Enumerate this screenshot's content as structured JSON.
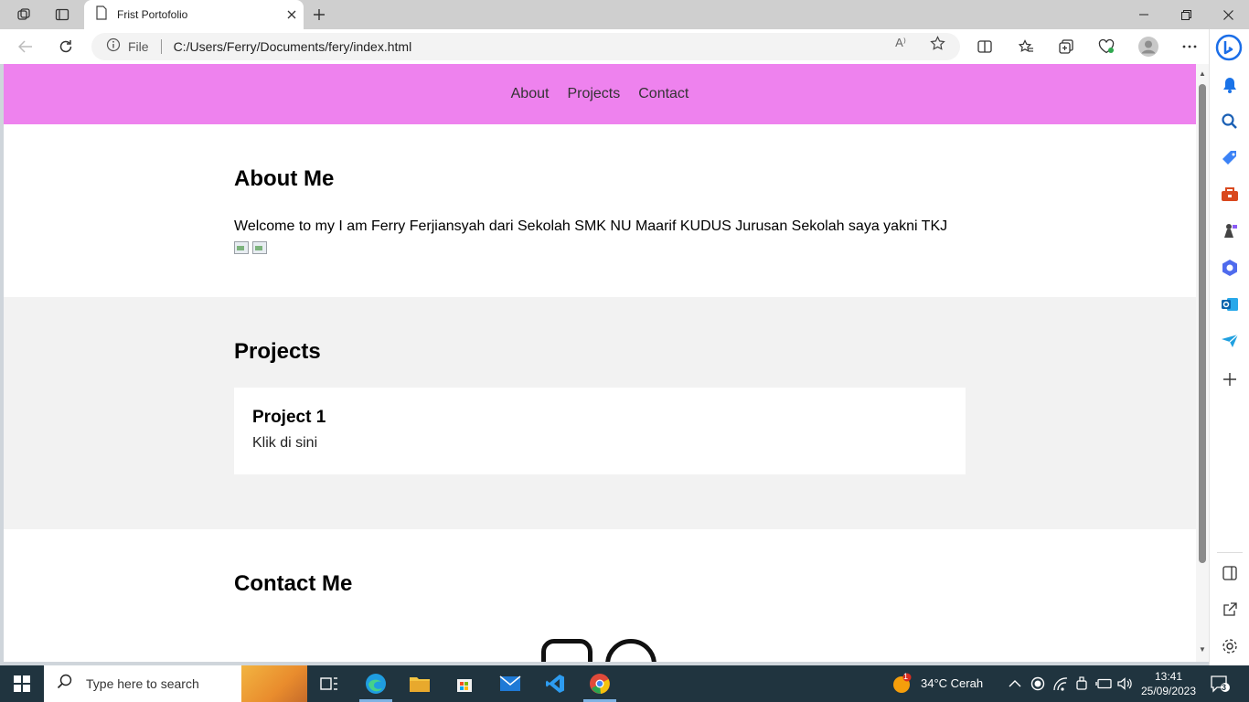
{
  "browser": {
    "tab_title": "Frist Portofolio",
    "address_scheme": "File",
    "address_url": "C:/Users/Ferry/Documents/fery/index.html",
    "read_aloud_label": "A⁾"
  },
  "site": {
    "nav": [
      "About",
      "Projects",
      "Contact"
    ],
    "about": {
      "heading": "About Me",
      "text": "Welcome to my I am Ferry Ferjiansyah dari Sekolah SMK NU Maarif KUDUS Jurusan Sekolah saya yakni TKJ"
    },
    "projects": {
      "heading": "Projects",
      "card_title": "Project 1",
      "card_link": "Klik di sini"
    },
    "contact": {
      "heading": "Contact Me"
    }
  },
  "sidebar_icons": [
    "bell-icon",
    "search-icon",
    "shopping-tag-icon",
    "toolbox-icon",
    "games-icon",
    "office-icon",
    "outlook-icon",
    "send-icon",
    "add-icon"
  ],
  "taskbar": {
    "search_placeholder": "Type here to search",
    "weather": "34°C  Cerah",
    "weather_badge": "1",
    "time": "13:41",
    "date": "25/09/2023",
    "notifications": "3"
  },
  "colors": {
    "site_nav_bg": "#ee82ee",
    "projects_bg": "#f2f2f2",
    "taskbar_bg": "#20343f"
  }
}
